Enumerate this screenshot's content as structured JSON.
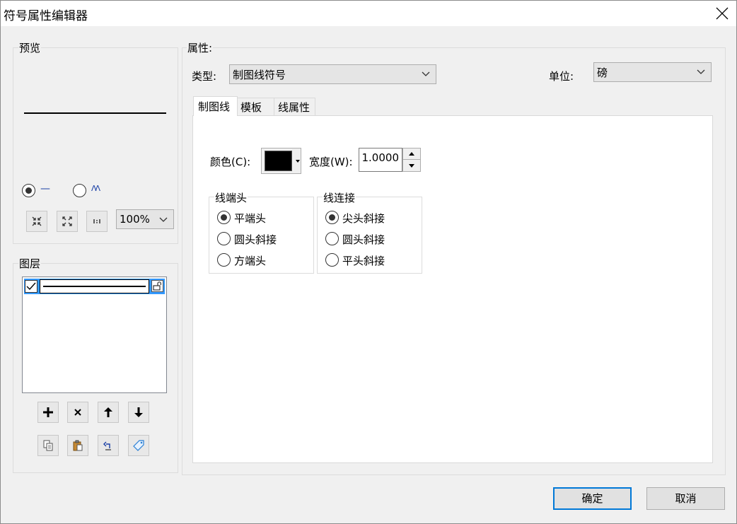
{
  "window": {
    "title": "符号属性编辑器"
  },
  "preview": {
    "label": "预览",
    "mode_line_glyph": "—",
    "mode_wave_glyph": "ᐱᐱ",
    "zoom": "100%"
  },
  "layers": {
    "label": "图层"
  },
  "properties": {
    "label": "属性:",
    "type_label": "类型:",
    "type_value": "制图线符号",
    "unit_label": "单位:",
    "unit_value": "磅",
    "tabs": [
      "制图线",
      "模板",
      "线属性"
    ],
    "color_label": "颜色(C):",
    "color_value": "#000000",
    "width_label": "宽度(W):",
    "width_value": "1.0000",
    "cap_group": {
      "label": "线端头",
      "options": [
        "平端头",
        "圆头斜接",
        "方端头"
      ]
    },
    "join_group": {
      "label": "线连接",
      "options": [
        "尖头斜接",
        "圆头斜接",
        "平头斜接"
      ]
    }
  },
  "footer": {
    "ok": "确定",
    "cancel": "取消"
  }
}
